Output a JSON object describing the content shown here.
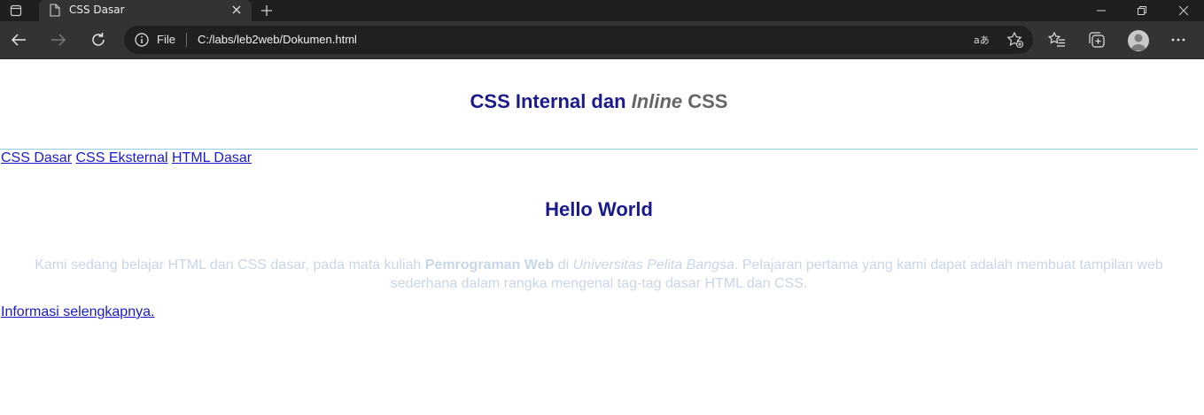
{
  "browser": {
    "tab": {
      "title": "CSS Dasar"
    },
    "address": {
      "scheme_label": "File",
      "url": "C:/labs/leb2web/Dokumen.html"
    }
  },
  "page": {
    "title": {
      "part1": "CSS Internal dan ",
      "part2": "Inline",
      "part3": " CSS"
    },
    "nav_links": [
      "CSS Dasar",
      "CSS Eksternal",
      "HTML Dasar"
    ],
    "heading": "Hello World",
    "paragraph": {
      "text1": "Kami sedang belajar HTML dan CSS dasar, pada mata kuliah ",
      "bold": "Pemrograman Web",
      "text2": " di ",
      "italic": "Universitas Pelita Bangsa",
      "text3": ". Pelajaran pertama yang kami dapat adalah membuat tampilan web sederhana dalam rangka mengenal tag-tag dasar HTML dan CSS."
    },
    "more_link": "Informasi selengkapnya."
  },
  "colors": {
    "heading": "#1a1a8c",
    "link": "#1a1acc",
    "paragraph": "#c8d6e8",
    "inline_css": "#666666",
    "rule": "#8fd0e0"
  }
}
